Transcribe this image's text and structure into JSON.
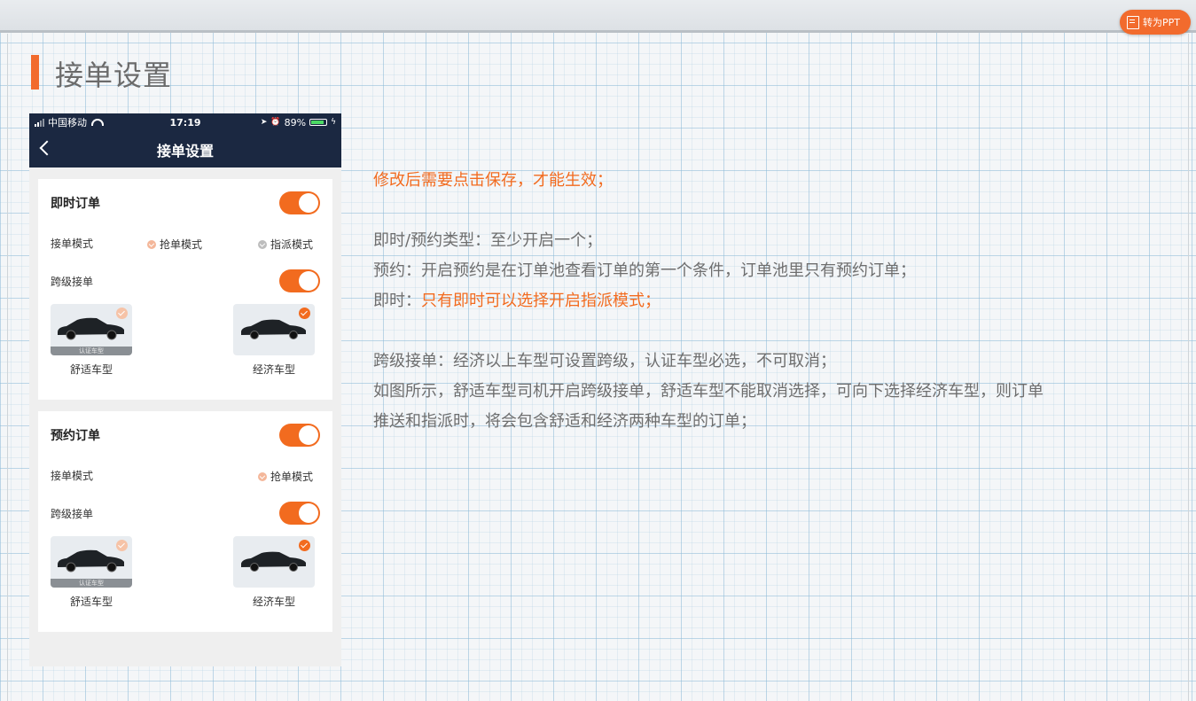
{
  "toolbar": {
    "ppt_button": "转为PPT"
  },
  "slide": {
    "title": "接单设置"
  },
  "phone": {
    "status": {
      "carrier": "中国移动",
      "time": "17:19",
      "battery": "89%"
    },
    "nav_title": "接单设置",
    "instant": {
      "title": "即时订单",
      "mode_label": "接单模式",
      "mode_options": [
        "抢单模式",
        "指派模式"
      ],
      "cross_label": "跨级接单",
      "cars": [
        {
          "name": "舒适车型",
          "tag": "认证车型"
        },
        {
          "name": "经济车型"
        }
      ]
    },
    "reserve": {
      "title": "预约订单",
      "mode_label": "接单模式",
      "mode_options": [
        "抢单模式"
      ],
      "cross_label": "跨级接单",
      "cars": [
        {
          "name": "舒适车型",
          "tag": "认证车型"
        },
        {
          "name": "经济车型"
        }
      ]
    }
  },
  "notes": {
    "line1": "修改后需要点击保存，才能生效；",
    "line2": "即时/预约类型：至少开启一个；",
    "line3": "预约：开启预约是在订单池查看订单的第一个条件，订单池里只有预约订单；",
    "line4_prefix": "即时：",
    "line4_highlight": "只有即时可以选择开启指派模式；",
    "line5": "跨级接单：经济以上车型可设置跨级，认证车型必选，不可取消；",
    "line6": "如图所示，舒适车型司机开启跨级接单，舒适车型不能取消选择，可向下选择经济车型，则订单",
    "line7": "推送和指派时，将会包含舒适和经济两种车型的订单；"
  },
  "colors": {
    "accent": "#f26b1f",
    "navy": "#1b2841"
  }
}
